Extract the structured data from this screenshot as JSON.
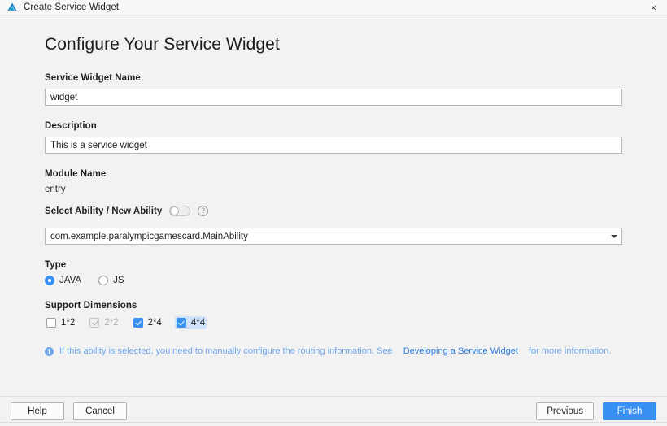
{
  "window": {
    "title": "Create Service Widget",
    "app_icon": "deveco-logo-icon",
    "close_label": "×"
  },
  "main": {
    "heading": "Configure Your Service Widget",
    "widget_name": {
      "label": "Service Widget Name",
      "value": "widget",
      "placeholder": ""
    },
    "description": {
      "label": "Description",
      "value": "This is a service widget",
      "placeholder": ""
    },
    "module_name": {
      "label": "Module Name",
      "value": "entry"
    },
    "select_ability": {
      "label": "Select Ability / New Ability",
      "toggle_state": "off",
      "help_glyph": "?"
    },
    "ability_select": {
      "value": "com.example.paralympicgamescard.MainAbility",
      "arrow_icon": "chevron-down-icon"
    },
    "type": {
      "label": "Type",
      "options": [
        {
          "label": "JAVA",
          "selected": true
        },
        {
          "label": "JS",
          "selected": false
        }
      ]
    },
    "support_dimensions": {
      "label": "Support Dimensions",
      "options": [
        {
          "label": "1*2",
          "checked": false,
          "disabled": false,
          "focused": false
        },
        {
          "label": "2*2",
          "checked": true,
          "disabled": true,
          "focused": false
        },
        {
          "label": "2*4",
          "checked": true,
          "disabled": false,
          "focused": false
        },
        {
          "label": "4*4",
          "checked": true,
          "disabled": false,
          "focused": true
        }
      ]
    },
    "note": {
      "icon_glyph": "i",
      "text_before": "If this ability is selected, you need to manually configure the routing information. See",
      "link_text": "Developing a Service Widget",
      "text_after": "for more information."
    }
  },
  "footer": {
    "help_label": "Help",
    "cancel_label_mnemonic": "C",
    "cancel_label_rest": "ancel",
    "previous_label_mnemonic": "P",
    "previous_label_rest": "revious",
    "finish_label_mnemonic": "F",
    "finish_label_rest": "inish"
  },
  "colors": {
    "accent": "#3890f5",
    "link": "#2a7de1",
    "note": "#6fa8ef",
    "background": "#f2f2f2"
  }
}
